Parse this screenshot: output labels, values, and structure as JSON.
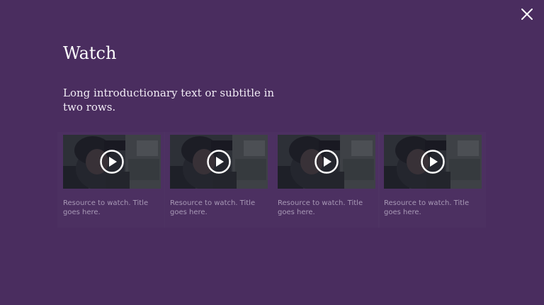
{
  "close": {
    "icon": "close-icon"
  },
  "header": {
    "title": "Watch",
    "subtitle": "Long introductionary text or subtitle in two rows."
  },
  "colors": {
    "background": "#4a2d5f",
    "title": "#ffffff",
    "card_title": "#a899b6"
  },
  "videos": [
    {
      "title": "Resource to watch. Title goes here.",
      "icon": "play-icon"
    },
    {
      "title": "Resource to watch. Title goes here.",
      "icon": "play-icon"
    },
    {
      "title": "Resource to watch. Title goes here.",
      "icon": "play-icon"
    },
    {
      "title": "Resource to watch. Title goes here.",
      "icon": "play-icon"
    }
  ]
}
